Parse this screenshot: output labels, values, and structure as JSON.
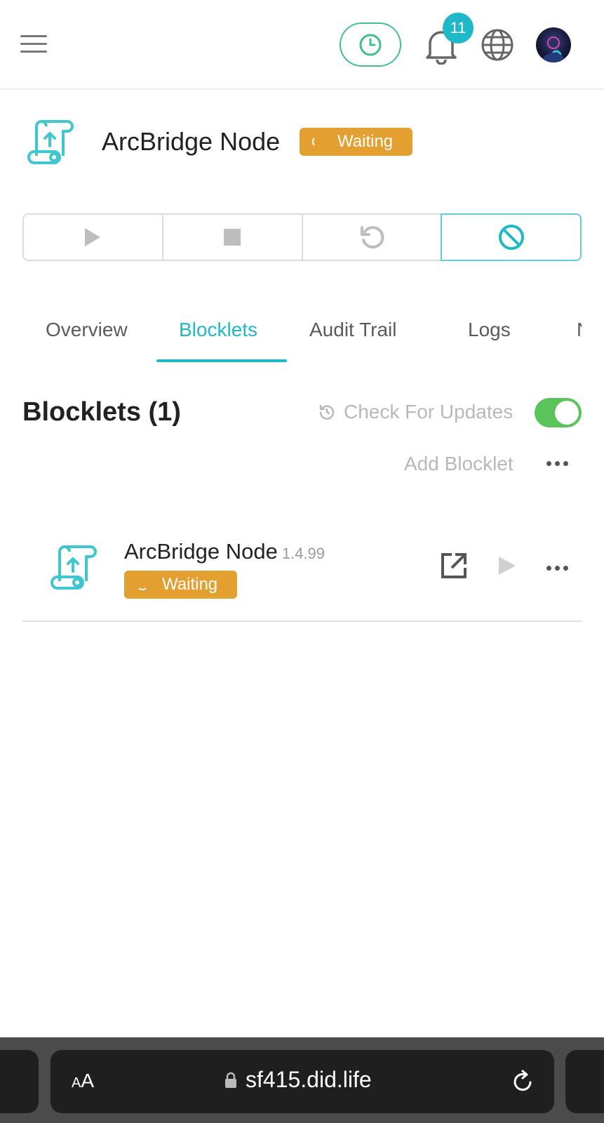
{
  "header": {
    "notification_count": "11",
    "icons": [
      "menu-icon",
      "clock-icon",
      "bell-icon",
      "globe-icon",
      "avatar"
    ]
  },
  "app": {
    "title": "ArcBridge Node",
    "status": "Waiting"
  },
  "controls": [
    "play-icon",
    "stop-icon",
    "restart-icon",
    "disable-icon"
  ],
  "tabs": [
    {
      "label": "Overview"
    },
    {
      "label": "Blocklets"
    },
    {
      "label": "Audit Trail"
    },
    {
      "label": "Logs"
    },
    {
      "label": "N"
    }
  ],
  "active_tab": "Blocklets",
  "section": {
    "title": "Blocklets (1)",
    "check_updates_label": "Check For Updates",
    "check_updates_enabled": true,
    "add_label": "Add Blocklet"
  },
  "blocklets": [
    {
      "name": "ArcBridge Node",
      "version": "1.4.99",
      "status": "Waiting"
    }
  ],
  "browser": {
    "aa_label_small": "A",
    "aa_label_large": "A",
    "host": "sf415.did.life"
  },
  "colors": {
    "accent": "#1fb8c9",
    "waiting": "#e3a031",
    "toggle_on": "#5ac35a",
    "clock_green": "#40c08a"
  }
}
